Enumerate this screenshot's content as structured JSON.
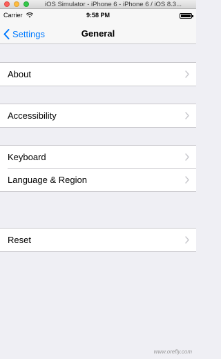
{
  "window": {
    "title": "iOS Simulator - iPhone 6 - iPhone 6 / iOS 8.3..."
  },
  "status_bar": {
    "carrier": "Carrier",
    "time": "9:58 PM",
    "wifi_icon": "wifi-icon",
    "battery_icon": "battery-icon"
  },
  "nav": {
    "back_label": "Settings",
    "title": "General"
  },
  "groups": [
    {
      "items": [
        {
          "label": "About"
        }
      ]
    },
    {
      "items": [
        {
          "label": "Accessibility"
        }
      ]
    },
    {
      "items": [
        {
          "label": "Keyboard"
        },
        {
          "label": "Language & Region"
        }
      ]
    },
    {
      "items": [
        {
          "label": "Reset"
        }
      ]
    }
  ],
  "watermark": "www.orefly.com",
  "colors": {
    "accent": "#007aff",
    "background": "#efeff4",
    "separator": "#c8c7cc",
    "chevron": "#c7c7cc"
  }
}
